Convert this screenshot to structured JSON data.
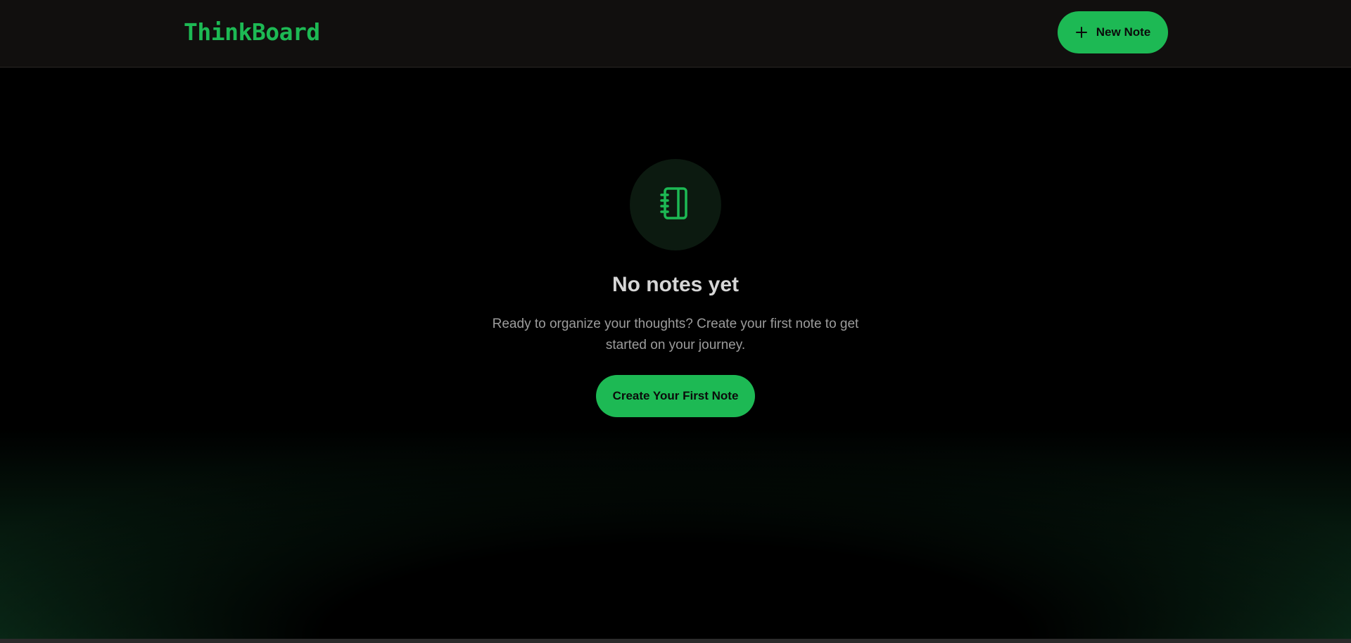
{
  "app": {
    "brand": "ThinkBoard",
    "accent_color": "#1db954"
  },
  "header": {
    "new_note_label": "New Note",
    "new_note_icon": "plus-icon"
  },
  "empty_state": {
    "icon": "notebook-icon",
    "title": "No notes yet",
    "description": "Ready to organize your thoughts? Create your first note to get started on your journey.",
    "cta_label": "Create Your First Note"
  }
}
